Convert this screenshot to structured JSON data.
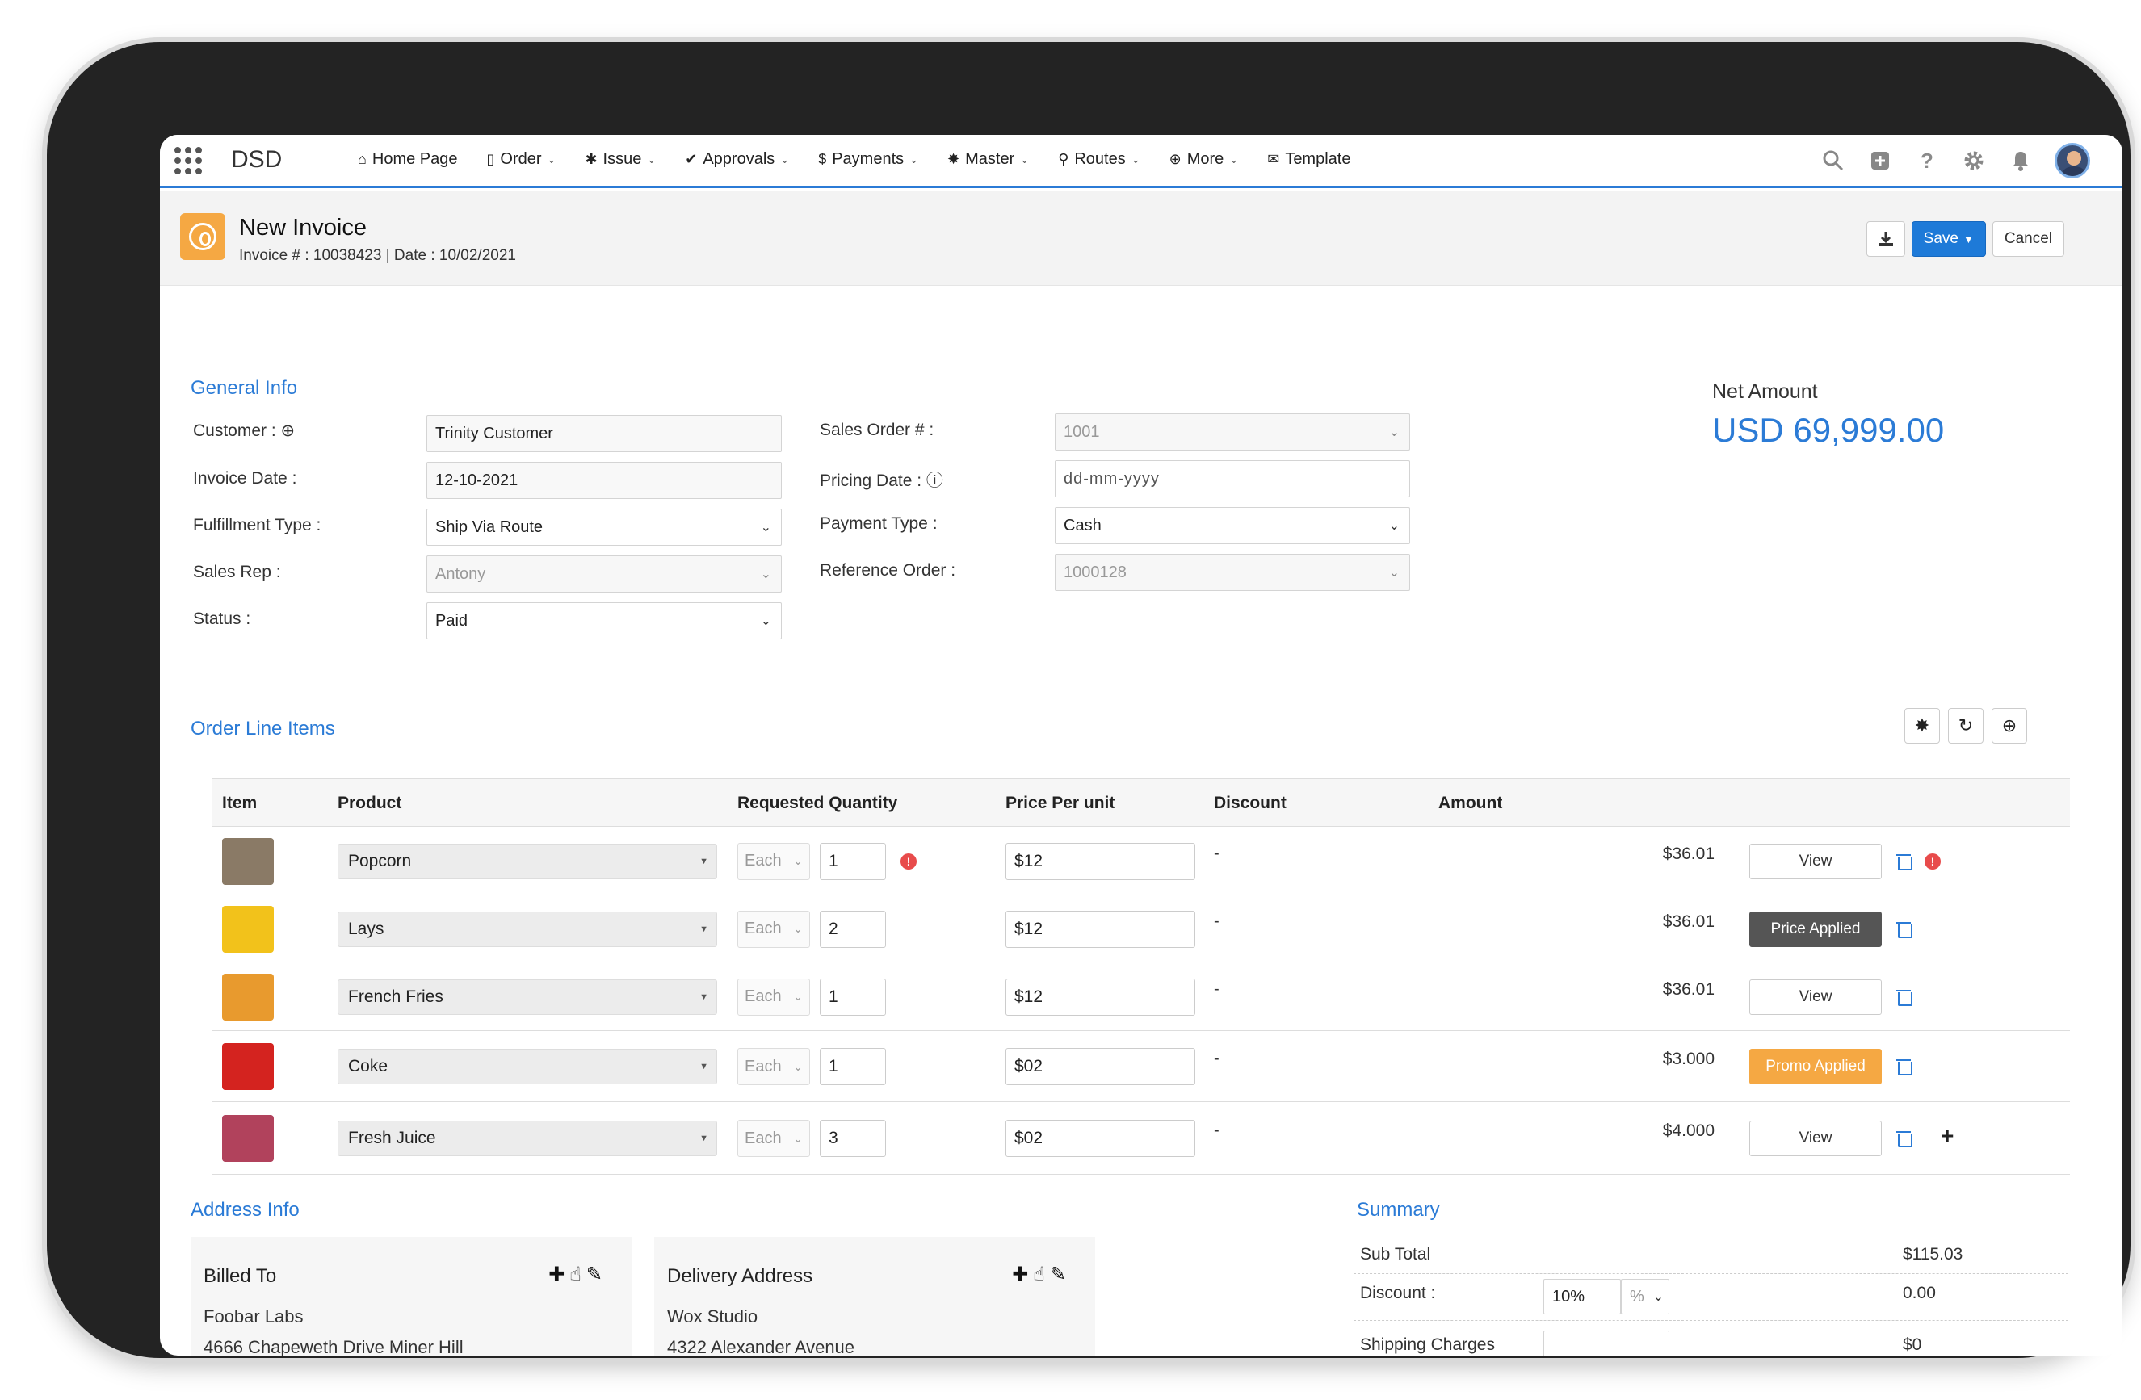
{
  "nav": {
    "app_name": "DSD",
    "items": [
      {
        "label": "Home Page",
        "icon": "home-icon",
        "glyph": "⌂",
        "chevron": false
      },
      {
        "label": "Order",
        "icon": "document-icon",
        "glyph": "▯",
        "chevron": true
      },
      {
        "label": "Issue",
        "icon": "bug-icon",
        "glyph": "✱",
        "chevron": true
      },
      {
        "label": "Approvals",
        "icon": "check-icon",
        "glyph": "✔",
        "chevron": true
      },
      {
        "label": "Payments",
        "icon": "dollar-icon",
        "glyph": "$",
        "chevron": true
      },
      {
        "label": "Master",
        "icon": "gear-icon",
        "glyph": "✸",
        "chevron": true
      },
      {
        "label": "Routes",
        "icon": "map-pin-icon",
        "glyph": "⚲",
        "chevron": true
      },
      {
        "label": "More",
        "icon": "plus-circle-icon",
        "glyph": "⊕",
        "chevron": true
      },
      {
        "label": "Template",
        "icon": "envelope-icon",
        "glyph": "✉",
        "chevron": false
      }
    ]
  },
  "header": {
    "title": "New Invoice",
    "subtitle": "Invoice # : 10038423 | Date : 10/02/2021",
    "save_label": "Save",
    "cancel_label": "Cancel"
  },
  "general": {
    "section_title": "General Info",
    "customer_label": "Customer :",
    "customer_value": "Trinity Customer",
    "invoice_date_label": "Invoice Date :",
    "invoice_date_value": "12-10-2021",
    "fulfillment_label": "Fulfillment Type :",
    "fulfillment_value": "Ship Via Route",
    "sales_rep_label": "Sales Rep :",
    "sales_rep_value": "Antony",
    "status_label": "Status :",
    "status_value": "Paid",
    "sales_order_label": "Sales Order # :",
    "sales_order_value": "1001",
    "pricing_date_label": "Pricing Date :",
    "pricing_date_value": "dd-mm-yyyy",
    "payment_type_label": "Payment Type :",
    "payment_type_value": "Cash",
    "reference_order_label": "Reference Order :",
    "reference_order_value": "1000128",
    "net_amount_label": "Net Amount",
    "net_amount_value": "USD 69,999.00"
  },
  "order_lines": {
    "section_title": "Order Line Items",
    "headers": [
      "Item",
      "Product",
      "Requested Quantity",
      "Price Per unit",
      "Discount",
      "Amount"
    ],
    "rows": [
      {
        "product": "Popcorn",
        "unit": "Each",
        "qty": "1",
        "price": "$12",
        "discount": "-",
        "amount": "$36.01",
        "action": "View",
        "action_style": "plain",
        "warning": true,
        "thumb_color": "#8a7a66"
      },
      {
        "product": "Lays",
        "unit": "Each",
        "qty": "2",
        "price": "$12",
        "discount": "-",
        "amount": "$36.01",
        "action": "Price Applied",
        "action_style": "dark",
        "warning": false,
        "thumb_color": "#f2c21b"
      },
      {
        "product": "French Fries",
        "unit": "Each",
        "qty": "1",
        "price": "$12",
        "discount": "-",
        "amount": "$36.01",
        "action": "View",
        "action_style": "plain",
        "warning": false,
        "thumb_color": "#e89a2e"
      },
      {
        "product": "Coke",
        "unit": "Each",
        "qty": "1",
        "price": "$02",
        "discount": "-",
        "amount": "$3.000",
        "action": "Promo Applied",
        "action_style": "orange",
        "warning": false,
        "thumb_color": "#d4231f"
      },
      {
        "product": "Fresh Juice",
        "unit": "Each",
        "qty": "3",
        "price": "$02",
        "discount": "-",
        "amount": "$4.000",
        "action": "View",
        "action_style": "plain",
        "warning": false,
        "thumb_color": "#b1425c"
      }
    ]
  },
  "address": {
    "section_title": "Address Info",
    "billed_title": "Billed To",
    "billed_name": "Foobar Labs",
    "billed_line": "4666 Chapeweth Drive Miner Hill",
    "delivery_title": "Delivery Address",
    "delivery_name": "Wox Studio",
    "delivery_line": "4322 Alexander Avenue"
  },
  "summary": {
    "section_title": "Summary",
    "sub_total_label": "Sub Total",
    "sub_total_value": "$115.03",
    "discount_label": "Discount :",
    "discount_input": "10%",
    "discount_unit": "%",
    "discount_value": "0.00",
    "shipping_label": "Shipping Charges",
    "shipping_value": "$0"
  }
}
